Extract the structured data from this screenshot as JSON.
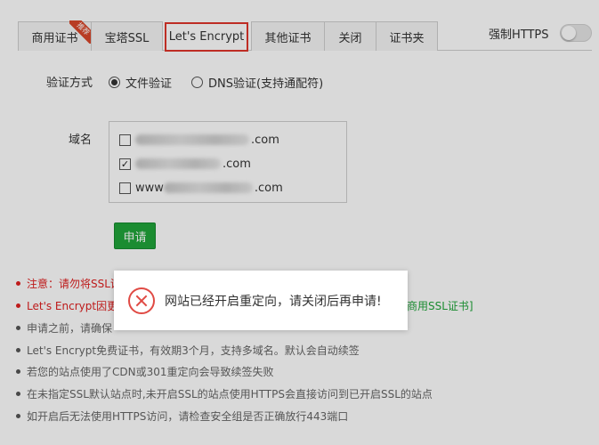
{
  "tabs": [
    {
      "label": "商用证书",
      "badge": "推荐"
    },
    {
      "label": "宝塔SSL"
    },
    {
      "label": "Let's Encrypt"
    },
    {
      "label": "其他证书"
    },
    {
      "label": "关闭"
    },
    {
      "label": "证书夹"
    }
  ],
  "https_toggle": {
    "label": "强制HTTPS",
    "enabled": false
  },
  "verify": {
    "label": "验证方式",
    "options": [
      {
        "label": "文件验证",
        "checked": true
      },
      {
        "label": "DNS验证(支持通配符)",
        "checked": false
      }
    ]
  },
  "domains": {
    "label": "域名",
    "items": [
      {
        "text": ".com",
        "checked": false
      },
      {
        "text": ".com",
        "checked": true
      },
      {
        "prefix": "www",
        "text": ".com",
        "checked": false
      }
    ]
  },
  "apply_button": "申请",
  "notes": {
    "n1": "注意：请勿将SSL证",
    "n2": "Let's Encrypt因更",
    "n2_link": "商用SSL证书]",
    "n3": "申请之前，请确保",
    "n4": "Let's Encrypt免费证书，有效期3个月，支持多域名。默认会自动续签",
    "n5": "若您的站点使用了CDN或301重定向会导致续签失败",
    "n6": "在未指定SSL默认站点时,未开启SSL的站点使用HTTPS会直接访问到已开启SSL的站点",
    "n7": "如开启后无法使用HTTPS访问，请检查安全组是否正确放行443端口"
  },
  "dialog": {
    "message": "网站已经开启重定向，请关闭后再申请!",
    "icon": "error-circle-icon"
  },
  "colors": {
    "accent_green": "#20a53a",
    "highlight_red": "#e0352b",
    "warning_red": "#e02020"
  }
}
